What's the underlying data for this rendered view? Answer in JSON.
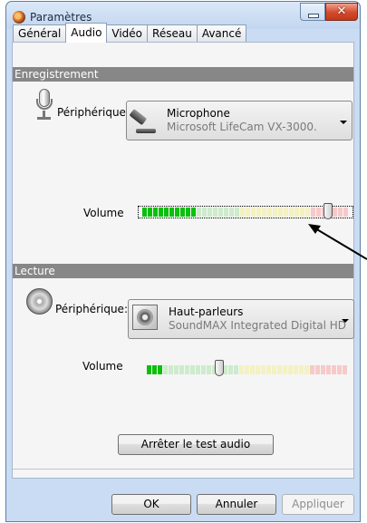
{
  "window": {
    "title": "Paramètres"
  },
  "tabs": [
    {
      "label": "Général",
      "active": false
    },
    {
      "label": "Audio",
      "active": true
    },
    {
      "label": "Vidéo",
      "active": false
    },
    {
      "label": "Réseau",
      "active": false
    },
    {
      "label": "Avancé",
      "active": false
    }
  ],
  "recording": {
    "section_title": "Enregistrement",
    "device_label": "Périphérique:",
    "device_name": "Microphone",
    "device_model": "Microsoft LifeCam VX-3000.",
    "volume_label": "Volume",
    "meter_level": 0.25,
    "volume_level": 0.9
  },
  "playback": {
    "section_title": "Lecture",
    "device_label": "Périphérique:",
    "device_name": "Haut-parleurs",
    "device_model": "SoundMAX Integrated Digital HD",
    "volume_label": "Volume",
    "meter_level": 0.08,
    "volume_level": 0.35
  },
  "buttons": {
    "stop_test": "Arrêter le test audio",
    "ok": "OK",
    "cancel": "Annuler",
    "apply": "Appliquer"
  },
  "icons": {
    "close": "✕"
  },
  "colors": {
    "meter_on": "#0dbf0d",
    "meter_off_green": "#cdebcd",
    "meter_off_yellow": "#f4f1c2",
    "meter_off_red": "#f7c9c9"
  }
}
